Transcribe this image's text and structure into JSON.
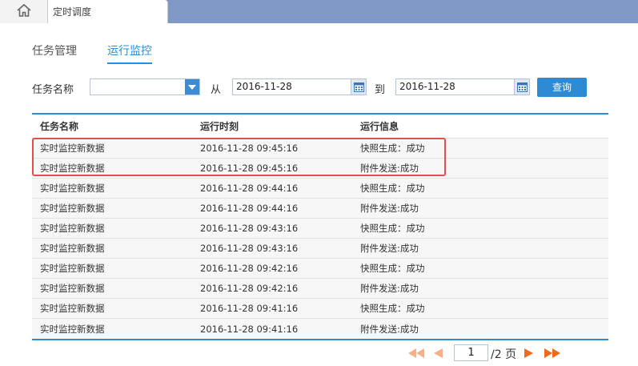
{
  "topbar": {
    "tab_title": "定时调度"
  },
  "subtabs": [
    {
      "label": "任务管理",
      "active": false
    },
    {
      "label": "运行监控",
      "active": true
    }
  ],
  "filter": {
    "task_name_label": "任务名称",
    "task_name_value": "",
    "from_label": "从",
    "from_date": "2016-11-28",
    "to_label": "到",
    "to_date": "2016-11-28",
    "query_label": "查询"
  },
  "table": {
    "headers": [
      "任务名称",
      "运行时刻",
      "运行信息"
    ],
    "rows": [
      [
        "实时监控新数据",
        "2016-11-28 09:45:16",
        "快照生成：成功"
      ],
      [
        "实时监控新数据",
        "2016-11-28 09:45:16",
        "附件发送:成功"
      ],
      [
        "实时监控新数据",
        "2016-11-28 09:44:16",
        "快照生成：成功"
      ],
      [
        "实时监控新数据",
        "2016-11-28 09:44:16",
        "附件发送:成功"
      ],
      [
        "实时监控新数据",
        "2016-11-28 09:43:16",
        "快照生成：成功"
      ],
      [
        "实时监控新数据",
        "2016-11-28 09:43:16",
        "附件发送:成功"
      ],
      [
        "实时监控新数据",
        "2016-11-28 09:42:16",
        "快照生成：成功"
      ],
      [
        "实时监控新数据",
        "2016-11-28 09:42:16",
        "附件发送:成功"
      ],
      [
        "实时监控新数据",
        "2016-11-28 09:41:16",
        "快照生成：成功"
      ],
      [
        "实时监控新数据",
        "2016-11-28 09:41:16",
        "附件发送:成功"
      ]
    ]
  },
  "pager": {
    "current_page": "1",
    "total_text": "/2 页"
  },
  "colors": {
    "accent": "#2e8bd3",
    "topbar": "#7f98c6",
    "pager_arrow": "#ee6a1c",
    "highlight": "#e05050"
  },
  "icons": {
    "home": "home-icon",
    "dropdown": "chevron-down-icon",
    "calendar": "calendar-icon"
  }
}
